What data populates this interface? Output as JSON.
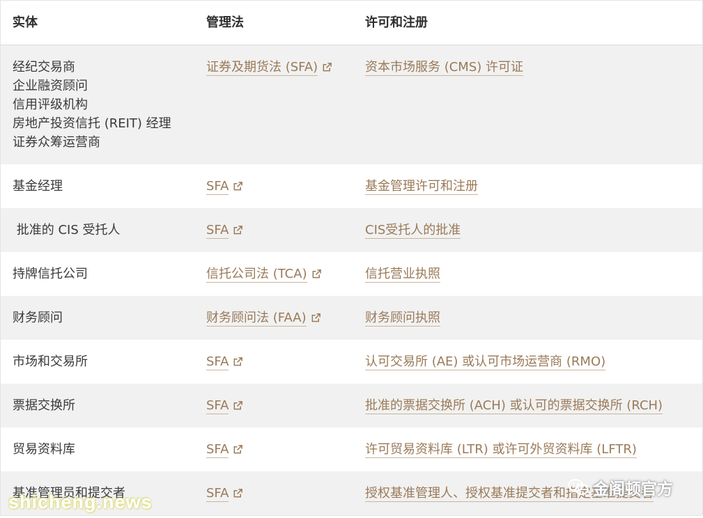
{
  "headers": {
    "entity": "实体",
    "law": "管理法",
    "license": "许可和注册"
  },
  "rows": [
    {
      "entity_lines": [
        "经纪交易商",
        "企业融资顾问",
        "信用评级机构",
        "房地产投资信托 (REIT) 经理",
        "证券众筹运营商"
      ],
      "law": "证券及期货法 (SFA)",
      "license": "资本市场服务 (CMS) 许可证"
    },
    {
      "entity": "基金经理",
      "law": "SFA",
      "license": "基金管理许可和注册"
    },
    {
      "entity": " 批准的 CIS 受托人",
      "law": "SFA",
      "license": "CIS受托人的批准"
    },
    {
      "entity": "持牌信托公司",
      "law": "信托公司法 (TCA)",
      "license": "信托营业执照"
    },
    {
      "entity": "财务顾问",
      "law": "财务顾问法 (FAA)",
      "license": "财务顾问执照"
    },
    {
      "entity": "市场和交易所",
      "law": "SFA",
      "license": "认可交易所 (AE) 或认可市场运营商 (RMO)"
    },
    {
      "entity": "票据交换所",
      "law": "SFA",
      "license": "批准的票据交换所 (ACH) 或认可的票据交换所 (RCH)"
    },
    {
      "entity": "贸易资料库",
      "law": "SFA",
      "license": "许可贸易资料库 (LTR) 或许可外贸资料库 (LFTR)"
    },
    {
      "entity": "基准管理员和提交者",
      "law": "SFA",
      "license": "授权基准管理人、授权基准提交者和指定基准提交者"
    }
  ],
  "watermarks": {
    "left": "shicheng.news",
    "right": "金阁顿官方"
  },
  "colors": {
    "link": "#9a7a58",
    "shade": "#f1f1f1"
  },
  "icons": {
    "external": "external-link-icon",
    "wechat": "wechat-icon"
  }
}
